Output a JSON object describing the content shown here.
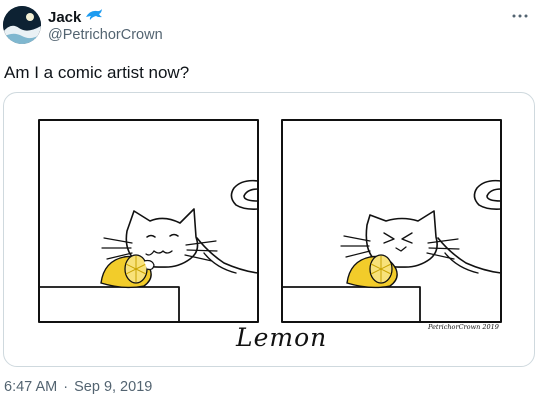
{
  "author": {
    "display_name": "Jack",
    "handle": "@PetrichorCrown",
    "avatar_icon": "avatar-image",
    "badge_icon": "dolphin-icon"
  },
  "tweet": {
    "text": "Am I a comic artist now?"
  },
  "comic": {
    "title": "Lemon",
    "signature": "PetrichorCrown 2019"
  },
  "meta": {
    "time": "6:47 AM",
    "separator": "·",
    "date": "Sep 9, 2019"
  },
  "colors": {
    "handle_gray": "#536471",
    "border": "#cfd9de",
    "lemon": "#f2cc2a",
    "badge_blue": "#1d9bf0"
  }
}
